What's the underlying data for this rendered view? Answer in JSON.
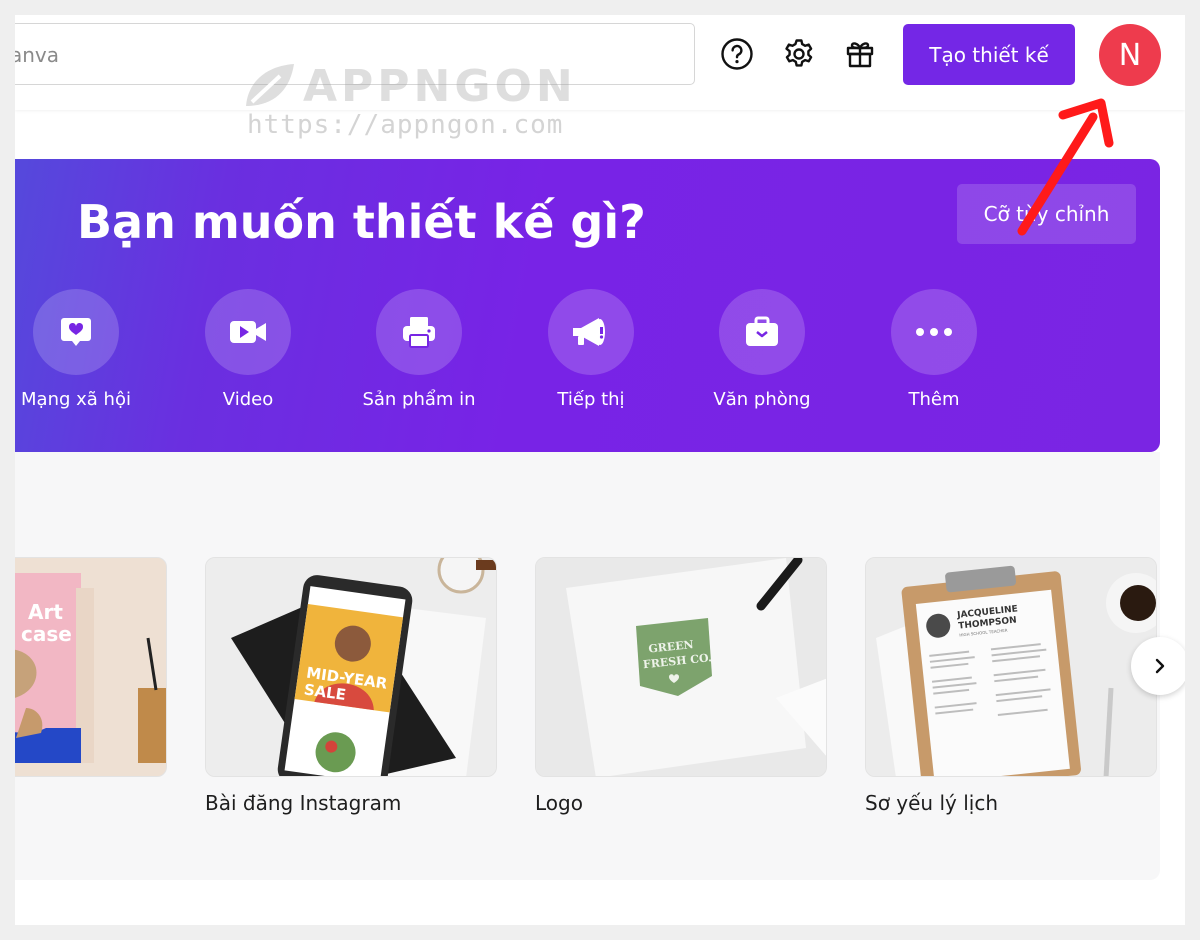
{
  "search": {
    "value": "Canva"
  },
  "header": {
    "help_icon": "question-circle-icon",
    "settings_icon": "gear-icon",
    "gift_icon": "gift-icon",
    "create_label": "Tạo thiết kế",
    "avatar_initial": "N"
  },
  "watermark": {
    "brand": "APPNGON",
    "url": "https://appngon.com"
  },
  "hero": {
    "title": "Bạn muốn thiết kế gì?",
    "custom_size_label": "Cỡ tùy chỉnh",
    "categories": [
      {
        "label": "Mạng xã hội",
        "icon": "heart-chat-icon"
      },
      {
        "label": "Video",
        "icon": "video-camera-icon"
      },
      {
        "label": "Sản phẩm in",
        "icon": "printer-icon"
      },
      {
        "label": "Tiếp thị",
        "icon": "megaphone-icon"
      },
      {
        "label": "Văn phòng",
        "icon": "briefcase-icon"
      },
      {
        "label": "Thêm",
        "icon": "more-dots-icon"
      }
    ]
  },
  "templates": [
    {
      "label": "",
      "art_text": "Art\ncase"
    },
    {
      "label": "Bài đăng Instagram",
      "art_text": "MID-YEAR SALE"
    },
    {
      "label": "Logo",
      "art_text": "GREEN FRESH CO."
    },
    {
      "label": "Sơ yếu lý lịch",
      "art_text": "JACQUELINE THOMPSON",
      "art_subtext": "HIGH SCHOOL TEACHER"
    }
  ],
  "colors": {
    "brand_purple": "#7427e6",
    "avatar_red": "#ee3b4d",
    "annotation_red": "#ff1a1a"
  }
}
